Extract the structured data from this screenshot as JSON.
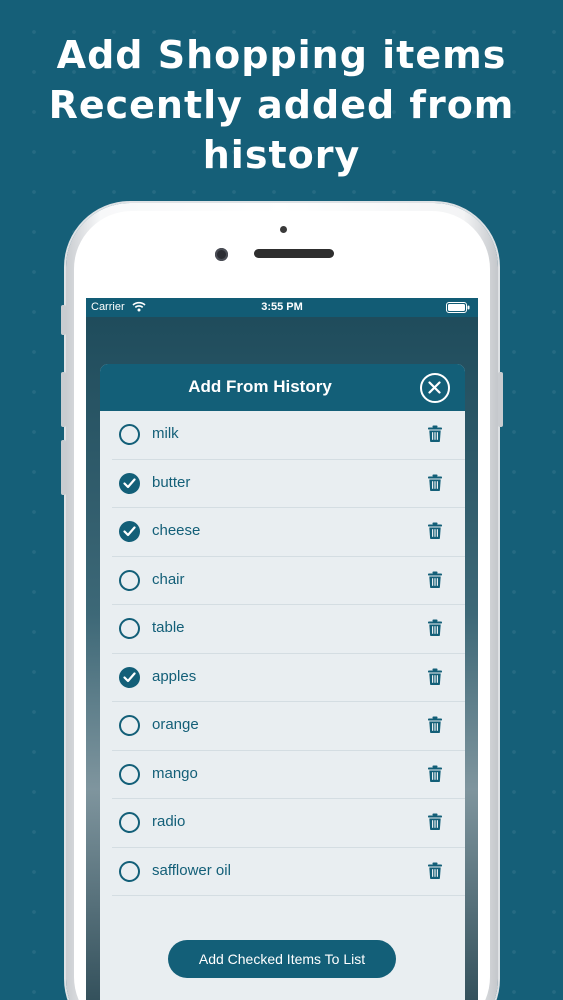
{
  "promo": {
    "line1": "Add Shopping items",
    "line2": "Recently added from",
    "line3": "history"
  },
  "status_bar": {
    "carrier": "Carrier",
    "time": "3:55 PM"
  },
  "modal": {
    "title": "Add From History",
    "add_button_label": "Add Checked Items To List"
  },
  "items": [
    {
      "label": "milk",
      "checked": false
    },
    {
      "label": "butter",
      "checked": true
    },
    {
      "label": "cheese",
      "checked": true
    },
    {
      "label": "chair",
      "checked": false
    },
    {
      "label": "table",
      "checked": false
    },
    {
      "label": "apples",
      "checked": true
    },
    {
      "label": "orange",
      "checked": false
    },
    {
      "label": "mango",
      "checked": false
    },
    {
      "label": "radio",
      "checked": false
    },
    {
      "label": "safflower oil",
      "checked": false
    }
  ],
  "colors": {
    "background": "#155f78",
    "accent": "#135f78",
    "modal_bg": "#e9eef1"
  }
}
